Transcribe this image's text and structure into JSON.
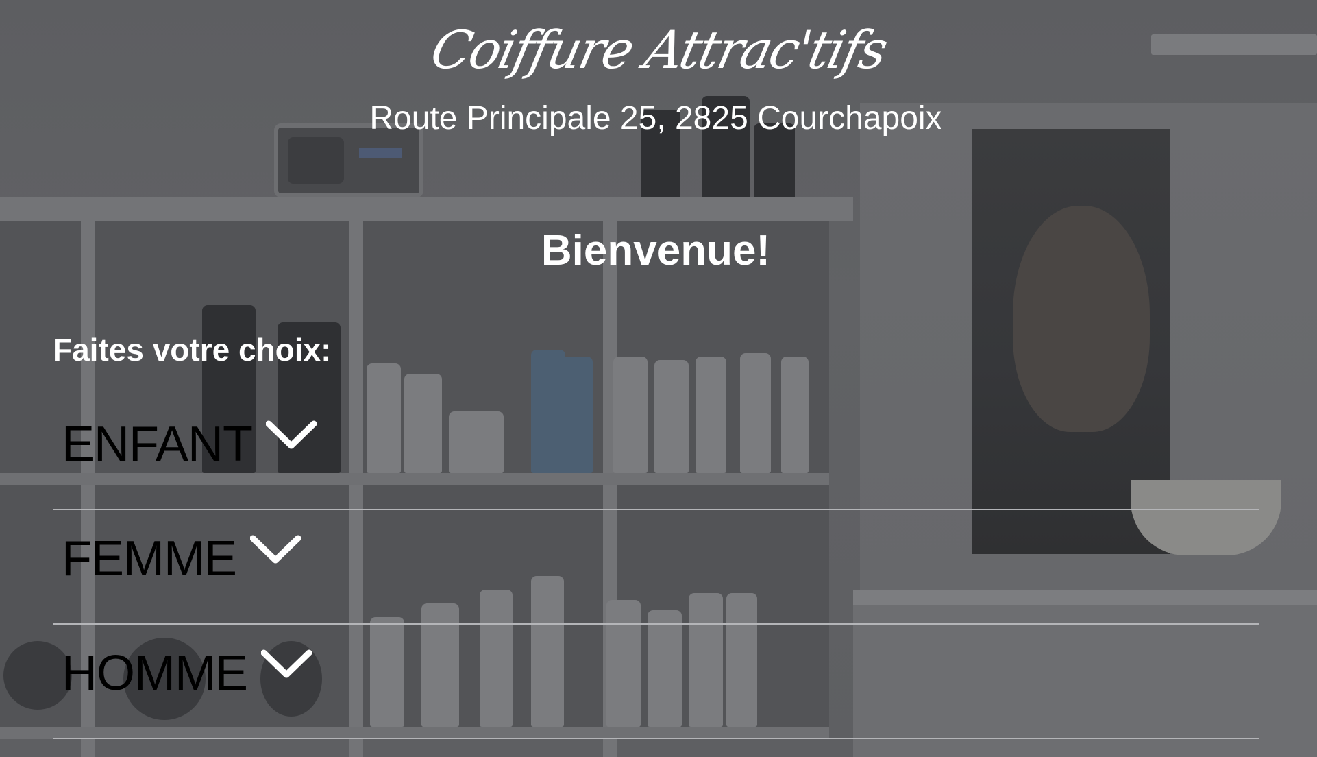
{
  "brand": {
    "name": "Coiffure Attrac'tifs"
  },
  "header": {
    "address": "Route Principale 25, 2825 Courchapoix"
  },
  "main": {
    "welcome": "Bienvenue!",
    "choice_label": "Faites votre choix:",
    "categories": [
      {
        "label": "ENFANT",
        "icon": "chevron-down-icon"
      },
      {
        "label": "FEMME",
        "icon": "chevron-down-icon"
      },
      {
        "label": "HOMME",
        "icon": "chevron-down-icon"
      }
    ]
  },
  "colors": {
    "overlay": "#5e5f62",
    "text_light": "#ffffff",
    "text_dark": "#000000",
    "divider": "#b4b5b8"
  }
}
